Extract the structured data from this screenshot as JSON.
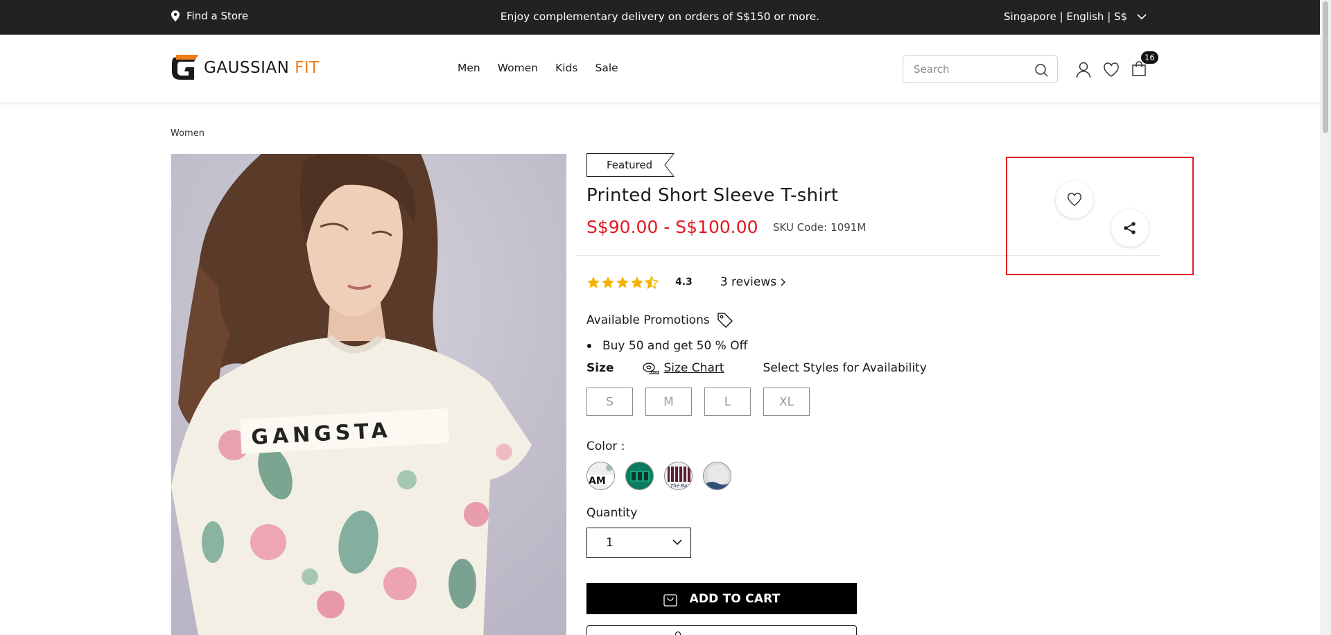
{
  "topbar": {
    "find_store": "Find a Store",
    "promo": "Enjoy complementary delivery on orders of S$150 or more.",
    "locale": "Singapore | English | S$"
  },
  "header": {
    "logo_main": "GAUSSIAN",
    "logo_accent": "FIT",
    "nav": [
      "Men",
      "Women",
      "Kids",
      "Sale"
    ],
    "search_placeholder": "Search",
    "cart_count": "16"
  },
  "breadcrumb": "Women",
  "product": {
    "badge": "Featured",
    "title": "Printed Short Sleeve T-shirt",
    "price": "S$90.00 - S$100.00",
    "sku_label": "SKU Code:",
    "sku_value": "1091M",
    "rating": 4.3,
    "rating_label": "4.3",
    "reviews": "3 reviews",
    "promotions_label": "Available Promotions",
    "promotions": [
      "Buy 50 and get 50 % Off"
    ],
    "size_label": "Size",
    "size_chart_label": "Size Chart",
    "availability_note": "Select Styles for Availability",
    "sizes": [
      "S",
      "M",
      "L",
      "XL"
    ],
    "color_label": "Color :",
    "colors": [
      "print-white",
      "teal-graphic",
      "maroon-stripe",
      "light-grey"
    ],
    "quantity_label": "Quantity",
    "quantity_value": "1",
    "add_to_cart": "ADD TO CART",
    "image_text": "GANGSTA"
  },
  "colors": {
    "accent_orange": "#f07d1a",
    "price_red": "#e4181f",
    "star_yellow": "#f5b301",
    "highlight_red": "#e0191f"
  }
}
